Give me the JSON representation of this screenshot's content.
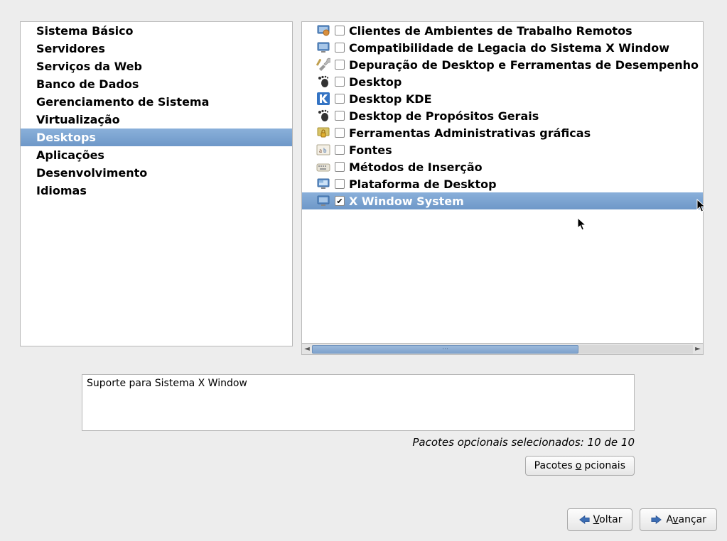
{
  "categories": [
    {
      "label": "Sistema Básico",
      "selected": false
    },
    {
      "label": "Servidores",
      "selected": false
    },
    {
      "label": "Serviços da Web",
      "selected": false
    },
    {
      "label": "Banco de Dados",
      "selected": false
    },
    {
      "label": "Gerenciamento de Sistema",
      "selected": false
    },
    {
      "label": "Virtualização",
      "selected": false
    },
    {
      "label": "Desktops",
      "selected": true
    },
    {
      "label": "Aplicações",
      "selected": false
    },
    {
      "label": "Desenvolvimento",
      "selected": false
    },
    {
      "label": "Idiomas",
      "selected": false
    }
  ],
  "packages": [
    {
      "icon": "remote-desktop",
      "checked": false,
      "label": "Clientes de Ambientes de Trabalho Remotos",
      "selected": false
    },
    {
      "icon": "monitor",
      "checked": false,
      "label": "Compatibilidade de Legacia do Sistema X Window",
      "selected": false
    },
    {
      "icon": "tools",
      "checked": false,
      "label": "Depuração de Desktop e Ferramentas de Desempenho",
      "selected": false
    },
    {
      "icon": "gnome-foot",
      "checked": false,
      "label": "Desktop",
      "selected": false
    },
    {
      "icon": "kde",
      "checked": false,
      "label": "Desktop KDE",
      "selected": false
    },
    {
      "icon": "gnome-foot",
      "checked": false,
      "label": "Desktop de Propósitos Gerais",
      "selected": false
    },
    {
      "icon": "lock",
      "checked": false,
      "label": "Ferramentas Administrativas gráficas",
      "selected": false
    },
    {
      "icon": "font",
      "checked": false,
      "label": "Fontes",
      "selected": false
    },
    {
      "icon": "input",
      "checked": false,
      "label": "Métodos de Inserção",
      "selected": false
    },
    {
      "icon": "platform",
      "checked": false,
      "label": "Plataforma de Desktop",
      "selected": false
    },
    {
      "icon": "monitor",
      "checked": true,
      "label": "X Window System",
      "selected": true
    }
  ],
  "description": "Suporte para Sistema X Window",
  "optional_status": "Pacotes opcionais selecionados: 10 de 10",
  "optional_button": {
    "prefix": "Pacotes ",
    "underline": "o",
    "suffix": "pcionais"
  },
  "back_button": {
    "underline": "V",
    "suffix": "oltar"
  },
  "forward_button": {
    "prefix": "A",
    "underline": "v",
    "suffix": "ançar"
  }
}
